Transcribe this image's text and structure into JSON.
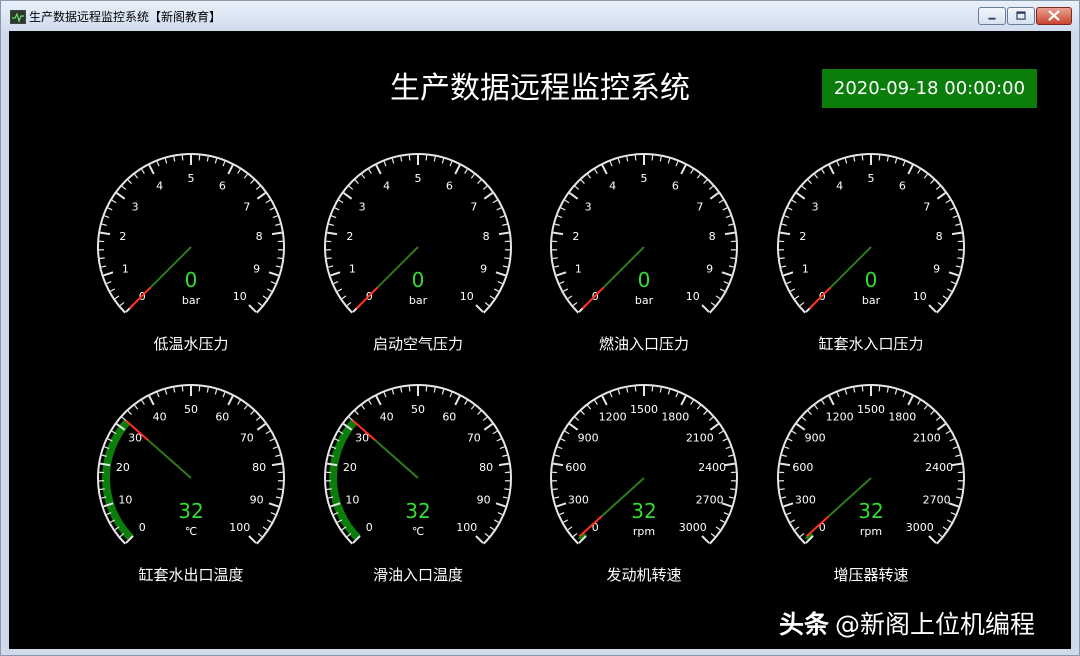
{
  "window": {
    "title": "生产数据远程监控系统【新阁教育】"
  },
  "header": {
    "title": "生产数据远程监控系统",
    "datetime": "2020-09-18 00:00:00"
  },
  "colors": {
    "background": "#000000",
    "accent_green": "#0a7d0a",
    "value_green": "#33dd33",
    "pointer_red": "#ff3322"
  },
  "gauges": [
    {
      "label": "低温水压力",
      "value": 0,
      "value_text": "0",
      "unit": "bar",
      "min": 0,
      "max": 10,
      "ticks": [
        "0",
        "1",
        "2",
        "3",
        "4",
        "5",
        "6",
        "7",
        "8",
        "9",
        "10"
      ],
      "green_range": [
        0,
        0
      ]
    },
    {
      "label": "启动空气压力",
      "value": 0,
      "value_text": "0",
      "unit": "bar",
      "min": 0,
      "max": 10,
      "ticks": [
        "0",
        "1",
        "2",
        "3",
        "4",
        "5",
        "6",
        "7",
        "8",
        "9",
        "10"
      ],
      "green_range": [
        0,
        0
      ]
    },
    {
      "label": "燃油入口压力",
      "value": 0,
      "value_text": "0",
      "unit": "bar",
      "min": 0,
      "max": 10,
      "ticks": [
        "0",
        "1",
        "2",
        "3",
        "4",
        "5",
        "6",
        "7",
        "8",
        "9",
        "10"
      ],
      "green_range": [
        0,
        0
      ]
    },
    {
      "label": "缸套水入口压力",
      "value": 0,
      "value_text": "0",
      "unit": "bar",
      "min": 0,
      "max": 10,
      "ticks": [
        "0",
        "1",
        "2",
        "3",
        "4",
        "5",
        "6",
        "7",
        "8",
        "9",
        "10"
      ],
      "green_range": [
        0,
        0
      ]
    },
    {
      "label": "缸套水出口温度",
      "value": 32,
      "value_text": "32",
      "unit": "℃",
      "min": 0,
      "max": 100,
      "ticks": [
        "0",
        "10",
        "20",
        "30",
        "40",
        "50",
        "60",
        "70",
        "80",
        "90",
        "100"
      ],
      "green_range": [
        0,
        32
      ]
    },
    {
      "label": "滑油入口温度",
      "value": 32,
      "value_text": "32",
      "unit": "℃",
      "min": 0,
      "max": 100,
      "ticks": [
        "0",
        "10",
        "20",
        "30",
        "40",
        "50",
        "60",
        "70",
        "80",
        "90",
        "100"
      ],
      "green_range": [
        0,
        32
      ]
    },
    {
      "label": "发动机转速",
      "value": 32,
      "value_text": "32",
      "unit": "rpm",
      "min": 0,
      "max": 3000,
      "ticks": [
        "0",
        "300",
        "600",
        "900",
        "1200",
        "1500",
        "1800",
        "2100",
        "2400",
        "2700",
        "3000"
      ],
      "green_range": [
        0,
        32
      ]
    },
    {
      "label": "增压器转速",
      "value": 32,
      "value_text": "32",
      "unit": "rpm",
      "min": 0,
      "max": 3000,
      "ticks": [
        "0",
        "300",
        "600",
        "900",
        "1200",
        "1500",
        "1800",
        "2100",
        "2400",
        "2700",
        "3000"
      ],
      "green_range": [
        0,
        32
      ]
    }
  ],
  "watermark": {
    "logo": "头条",
    "handle": "@新阁上位机编程"
  }
}
